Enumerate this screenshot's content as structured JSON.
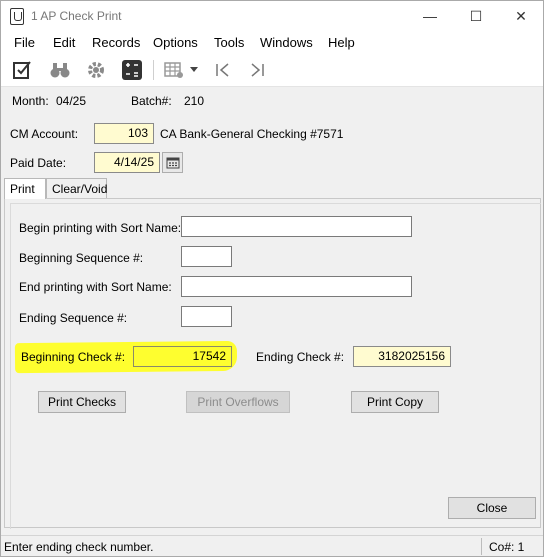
{
  "window": {
    "title": "1 AP Check Print",
    "minimize_glyph": "—",
    "maximize_glyph": "☐",
    "close_glyph": "✕"
  },
  "menu": {
    "items": [
      "File",
      "Edit",
      "Records",
      "Options",
      "Tools",
      "Windows",
      "Help"
    ]
  },
  "toolbar": {
    "icons": [
      "edit-checklist-icon",
      "binoculars-icon",
      "settings-gear-icon",
      "calculator-icon",
      "grid-settings-icon",
      "dropdown-arrow-icon",
      "first-record-icon",
      "last-record-icon"
    ]
  },
  "header": {
    "month_label": "Month:",
    "month_value": "04/25",
    "batch_label": "Batch#:",
    "batch_value": "210"
  },
  "form": {
    "cm_account_label": "CM Account:",
    "cm_account_value": "103",
    "cm_account_desc": "CA Bank-General Checking #7571",
    "paid_date_label": "Paid Date:",
    "paid_date_value": "4/14/25"
  },
  "tabs": [
    "Print",
    "Clear/Void"
  ],
  "print_tab": {
    "begin_sort_label": "Begin printing with Sort Name:",
    "begin_sort_value": "",
    "begin_seq_label": "Beginning Sequence #:",
    "begin_seq_value": "",
    "end_sort_label": "End printing with Sort Name:",
    "end_sort_value": "",
    "end_seq_label": "Ending Sequence #:",
    "end_seq_value": "",
    "begin_check_label": "Beginning Check #:",
    "begin_check_value": "17542",
    "end_check_label": "Ending Check #:",
    "end_check_value": "3182025156",
    "print_checks_label": "Print Checks",
    "print_overflows_label": "Print Overflows",
    "print_copy_label": "Print Copy"
  },
  "close_label": "Close",
  "status": {
    "message": "Enter ending check number.",
    "company": "Co#: 1"
  },
  "colors": {
    "highlight": "#ffff1a",
    "field_yellow": "#fffbd0"
  }
}
